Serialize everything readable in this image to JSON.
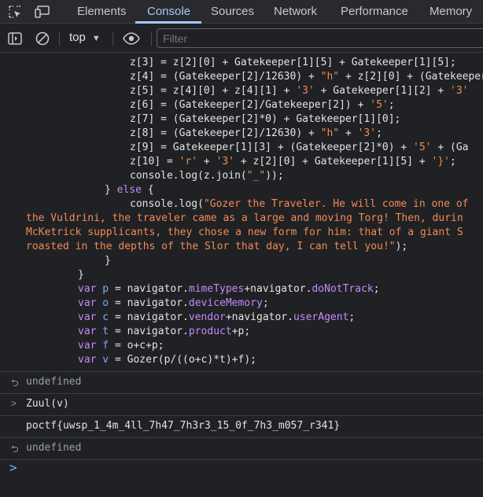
{
  "tabs": [
    "Elements",
    "Console",
    "Sources",
    "Network",
    "Performance",
    "Memory"
  ],
  "active_tab": "Console",
  "toolbar": {
    "context": "top",
    "filter_placeholder": "Filter"
  },
  "code_lines": {
    "l0": "z[3] = z[2][0] + Gatekeeper[1][5] + Gatekeeper[1][5];",
    "l1a": "z[4] = (Gatekeeper[2]/12630) + ",
    "l1b": "\"h\"",
    "l1c": " + z[2][0] + (Gatekeeper",
    "l2a": "z[5] = z[4][0] + z[4][1] + ",
    "l2b": "'3'",
    "l2c": " + Gatekeeper[1][2] + ",
    "l2d": "'3'",
    "l3a": "z[6] = (Gatekeeper[2]/Gatekeeper[2]) + ",
    "l3b": "'5'",
    "l3c": ";",
    "l4": "z[7] = (Gatekeeper[2]*0) + Gatekeeper[1][0];",
    "l5a": "z[8] = (Gatekeeper[2]/12630) + ",
    "l5b": "\"h\"",
    "l5c": " + ",
    "l5d": "'3'",
    "l5e": ";",
    "l6a": "z[9] = Gatekeeper[1][3] + (Gatekeeper[2]*0) + ",
    "l6b": "'5'",
    "l6c": " + (Ga",
    "l7a": "z[10] = ",
    "l7b": "'r'",
    "l7c": " + ",
    "l7d": "'3'",
    "l7e": " + z[2][0] + Gatekeeper[1][5] + ",
    "l7f": "'}'",
    "l7g": ";",
    "l8a": "console.",
    "l8b": "log",
    "l8c": "(z.",
    "l8d": "join",
    "l8e": "(",
    "l8f": "\"_\"",
    "l8g": "));",
    "l9a": "} ",
    "l9b": "else",
    "l9c": " {",
    "l10a": "console.",
    "l10b": "log",
    "l10c": "(",
    "l10d": "\"Gozer the Traveler. He will come in one of",
    "l11": "the Vuldrini, the traveler came as a large and moving Torg! Then, durin",
    "l12": "McKetrick supplicants, they chose a new form for him: that of a giant S",
    "l13a": "roasted in the depths of the Slor that day, I can tell you!\"",
    "l13b": ");",
    "l14": "}",
    "l15": "}",
    "l16a": "var",
    "l16b": " p",
    "l16c": " = navigator.",
    "l16d": "mimeTypes",
    "l16e": "+navigator.",
    "l16f": "doNotTrack",
    "l16g": ";",
    "l17a": "var",
    "l17b": " o",
    "l17c": " = navigator.",
    "l17d": "deviceMemory",
    "l17e": ";",
    "l18a": "var",
    "l18b": " c",
    "l18c": " = navigator.",
    "l18d": "vendor",
    "l18e": "+navigator.",
    "l18f": "userAgent",
    "l18g": ";",
    "l19a": "var",
    "l19b": " t",
    "l19c": " = navigator.",
    "l19d": "product",
    "l19e": "+p;",
    "l20a": "var",
    "l20b": " f",
    "l20c": " = o+c+p;",
    "l21a": "var",
    "l21b": " v",
    "l21c": " = Gozer(p/((o+c)*t)+f);"
  },
  "console": {
    "result1": "undefined",
    "input2": "Zuul(v)",
    "output2": "poctf{uwsp_1_4m_4ll_7h47_7h3r3_15_0f_7h3_m057_r341}",
    "result2": "undefined"
  }
}
